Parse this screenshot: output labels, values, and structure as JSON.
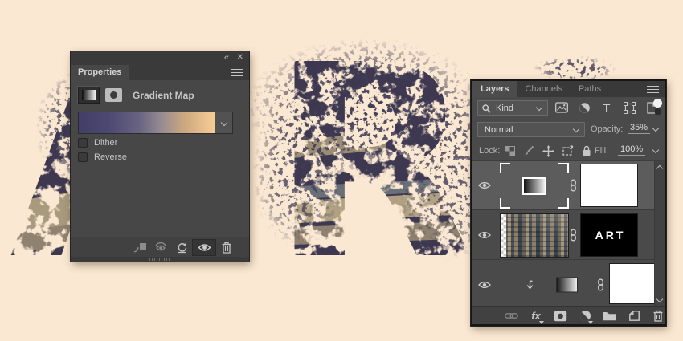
{
  "canvas": {
    "background": "#fbe8d2",
    "texture_base_color": "#3d3950",
    "letter_left": "A",
    "letter_center": "R",
    "depicted_word": "ART"
  },
  "properties_panel": {
    "collapse_icon": "«",
    "close_icon": "✕",
    "tab_label": "Properties",
    "title": "Gradient Map",
    "gradient_start_color": "#433e66",
    "gradient_end_color": "#f7cd97",
    "checkbox_dither": "Dither",
    "checkbox_reverse": "Reverse",
    "dither_checked": false,
    "reverse_checked": false
  },
  "layers_panel": {
    "tabs": [
      "Layers",
      "Channels",
      "Paths"
    ],
    "filter_kind": "Kind",
    "type_icon_letter": "T",
    "blend_mode": "Normal",
    "opacity_label": "Opacity:",
    "opacity_value": "35%",
    "lock_label": "Lock:",
    "fill_label": "Fill:",
    "fill_value": "100%",
    "mask_text": "ART",
    "fx_label": "fx",
    "layers": [
      {
        "kind": "gradient-map-adjustment",
        "selected": true,
        "visible": true,
        "mask": "white",
        "linked": true
      },
      {
        "kind": "city-photo",
        "selected": false,
        "visible": true,
        "mask": "ART text on black",
        "linked": true
      },
      {
        "kind": "clipped-gradient-fill",
        "selected": false,
        "visible": true,
        "mask": "white",
        "linked": true,
        "clipped": true
      }
    ]
  },
  "icons": {
    "eye": "visibility toggle",
    "chain": "mask link",
    "search": "filter search",
    "menu": "panel menu",
    "chevron": "dropdown arrow"
  }
}
